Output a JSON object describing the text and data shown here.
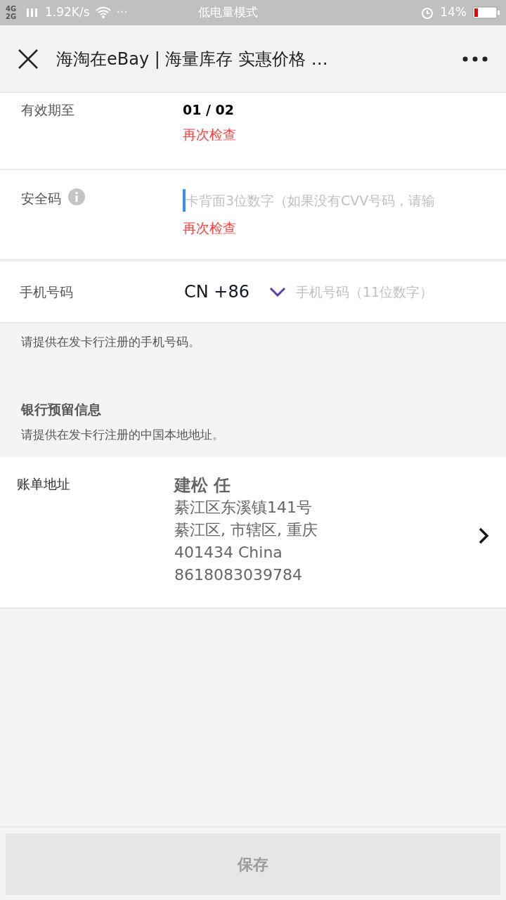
{
  "status_bar": {
    "network": "4G 2G",
    "speed": "1.92K/s",
    "more": "···",
    "mode": "低电量模式",
    "battery": "14%"
  },
  "header": {
    "title": "海淘在eBay | 海量库存 实惠价格 …"
  },
  "expiry": {
    "label": "有效期至",
    "value": "01 / 02",
    "error": "再次检查"
  },
  "cvv": {
    "label": "安全码",
    "placeholder": "卡背面3位数字（如果没有CVV号码，请输",
    "focused": true,
    "error": "再次检查"
  },
  "phone": {
    "label": "手机号码",
    "country": "CN +86",
    "placeholder": "手机号码（11位数字）",
    "hint": "请提供在发卡行注册的手机号码。"
  },
  "bank_info": {
    "title": "银行预留信息",
    "hint": "请提供在发卡行注册的中国本地地址。"
  },
  "billing_address": {
    "label": "账单地址",
    "name": "建松 任",
    "lines": [
      "綦江区东溪镇141号",
      "綦江区, 市辖区, 重庆",
      "401434 China",
      "8618083039784"
    ]
  },
  "save_button": {
    "label": "保存",
    "disabled": true
  }
}
